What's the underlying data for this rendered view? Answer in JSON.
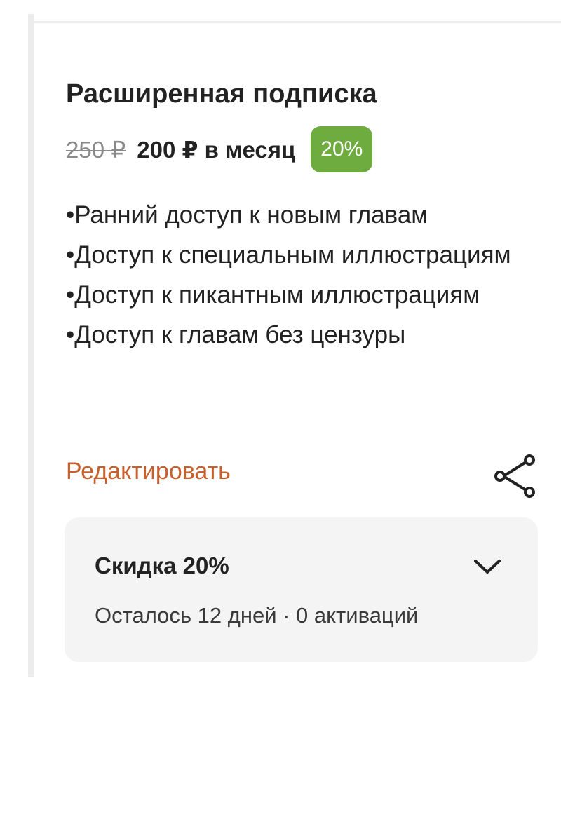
{
  "subscription": {
    "title": "Расширенная подписка",
    "old_price": "250 ₽",
    "price_text": "200 ₽ в месяц",
    "discount_badge": "20%",
    "features": [
      "•Ранний доступ к новым главам",
      "•Доступ к специальным иллюстрациям",
      "•Доступ к пикантным иллюстрациям",
      "•Доступ к главам без цензуры"
    ],
    "edit_label": "Редактировать",
    "share_icon": "share-icon"
  },
  "discount": {
    "title": "Скидка 20%",
    "details": "Осталось 12 дней · 0 активаций",
    "expand_icon": "chevron-down-icon"
  },
  "colors": {
    "badge": "#6fac3f",
    "edit_link": "#c8602e",
    "discount_panel": "#f4f4f4",
    "text": "#222222"
  }
}
